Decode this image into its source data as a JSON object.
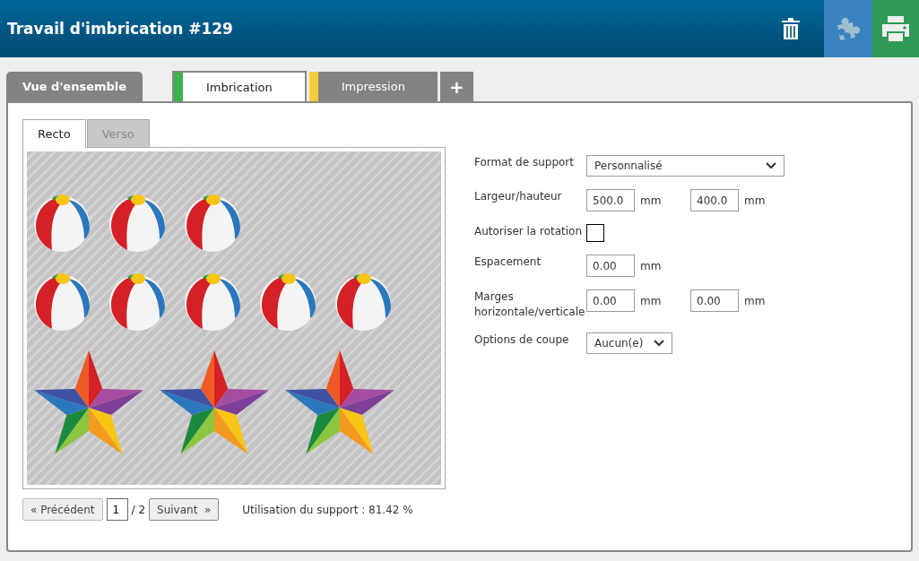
{
  "window": {
    "title": "Travail d'imbrication #129"
  },
  "tabs": [
    {
      "label": "Vue d'ensemble",
      "selected": false
    },
    {
      "label": "Imbrication",
      "selected": true,
      "color": "#3cb44b"
    },
    {
      "label": "Impression",
      "selected": false,
      "color": "#f5cd3c"
    }
  ],
  "add_tab": "+",
  "sides": [
    {
      "label": "Recto",
      "selected": true
    },
    {
      "label": "Verso",
      "selected": false
    }
  ],
  "layout": [
    [
      {
        "kind": "ball"
      },
      {
        "kind": "ball"
      },
      {
        "kind": "ball"
      }
    ],
    [
      {
        "kind": "ball"
      },
      {
        "kind": "ball"
      },
      {
        "kind": "ball"
      },
      {
        "kind": "ball"
      },
      {
        "kind": "ball"
      }
    ],
    [
      {
        "kind": "star"
      },
      {
        "kind": "star"
      },
      {
        "kind": "star"
      }
    ]
  ],
  "pagination": {
    "previous": "« Précédent",
    "page": "1",
    "total": "/ 2",
    "next": "Suivant  »"
  },
  "usage": "Utilisation du support : 81.42 %",
  "fields": [
    {
      "kind": "select",
      "label": "Format de support",
      "value": "Personnalisé"
    },
    {
      "kind": "pair",
      "label": "Largeur/hauteur",
      "value": "500.0",
      "unit": "mm",
      "value2": "400.0",
      "unit2": "mm"
    },
    {
      "kind": "checkbox",
      "label": "Autoriser la rotation",
      "checked": false
    },
    {
      "kind": "single",
      "label": "Espacement",
      "value": "0.00",
      "unit": "mm"
    },
    {
      "kind": "pair",
      "label": "Marges horizontale/verticale",
      "value": "0.00",
      "unit": "mm",
      "value2": "0.00",
      "unit2": "mm"
    },
    {
      "kind": "small-select",
      "label": "Options de coupe",
      "value": "Aucun(e)"
    }
  ]
}
